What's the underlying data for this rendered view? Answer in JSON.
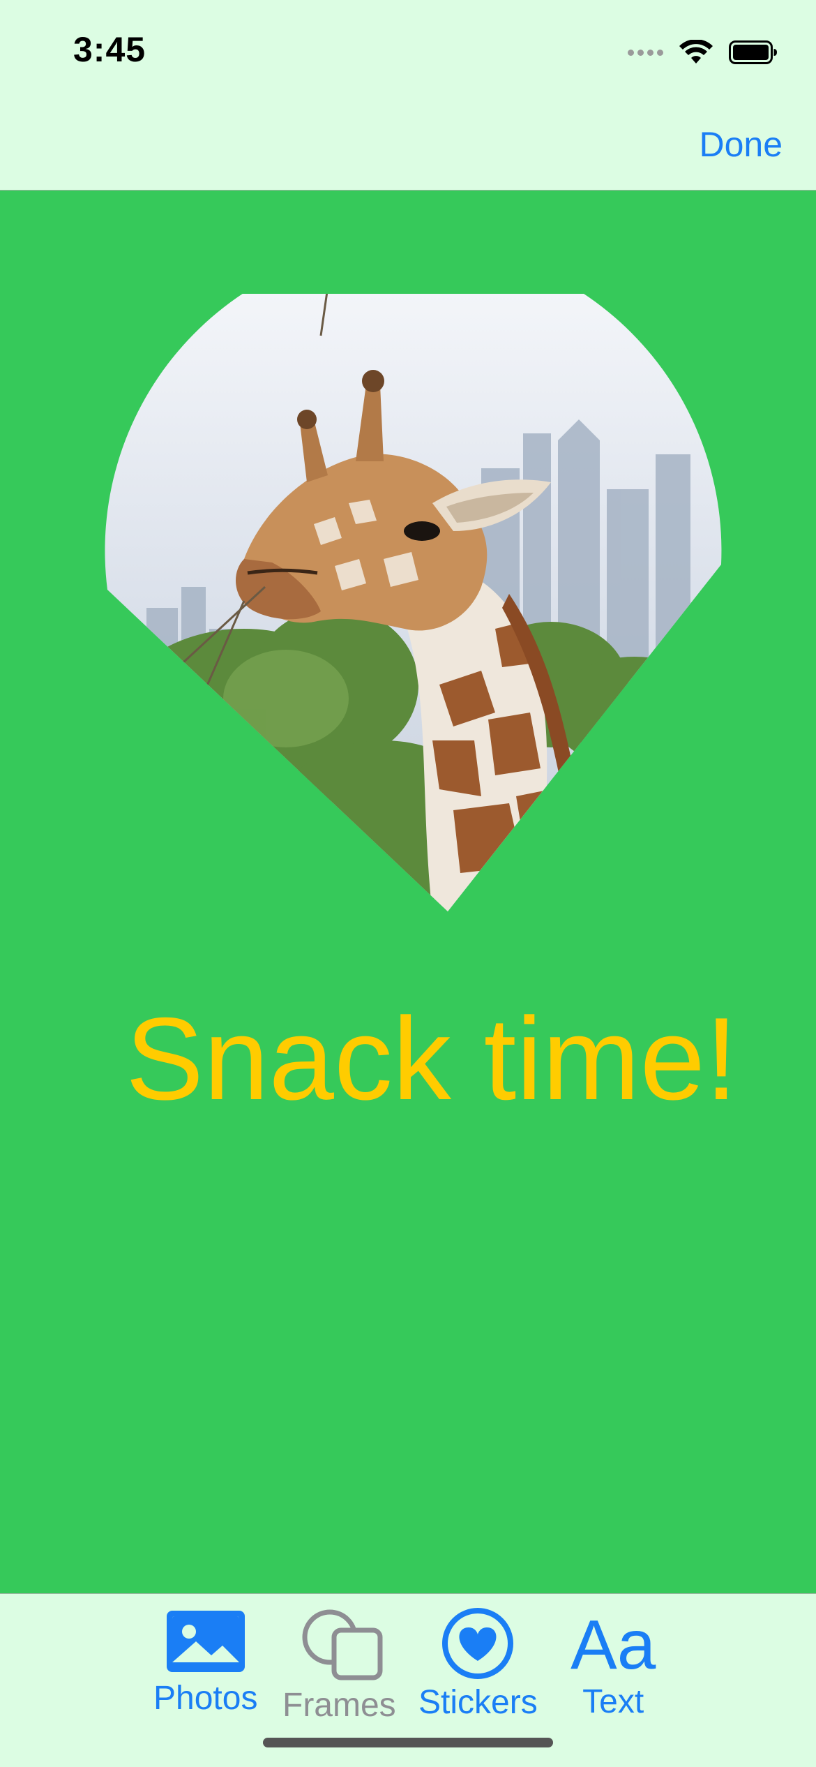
{
  "status_bar": {
    "time": "3:45"
  },
  "nav": {
    "done_label": "Done"
  },
  "canvas": {
    "background_color": "#36c95a",
    "caption": "Snack time!",
    "caption_color": "#ffcc00",
    "photo_subject": "giraffe-photo"
  },
  "tabs": [
    {
      "label": "Photos",
      "icon": "photo-icon",
      "active": true
    },
    {
      "label": "Frames",
      "icon": "frames-icon",
      "active": false
    },
    {
      "label": "Stickers",
      "icon": "heart-sticker-icon",
      "active": true
    },
    {
      "label": "Text",
      "icon": "text-icon",
      "glyph": "Aa",
      "active": true
    }
  ],
  "colors": {
    "accent": "#1a7ef5",
    "inactive": "#8e8e93",
    "chrome_background": "#dcfde3"
  }
}
